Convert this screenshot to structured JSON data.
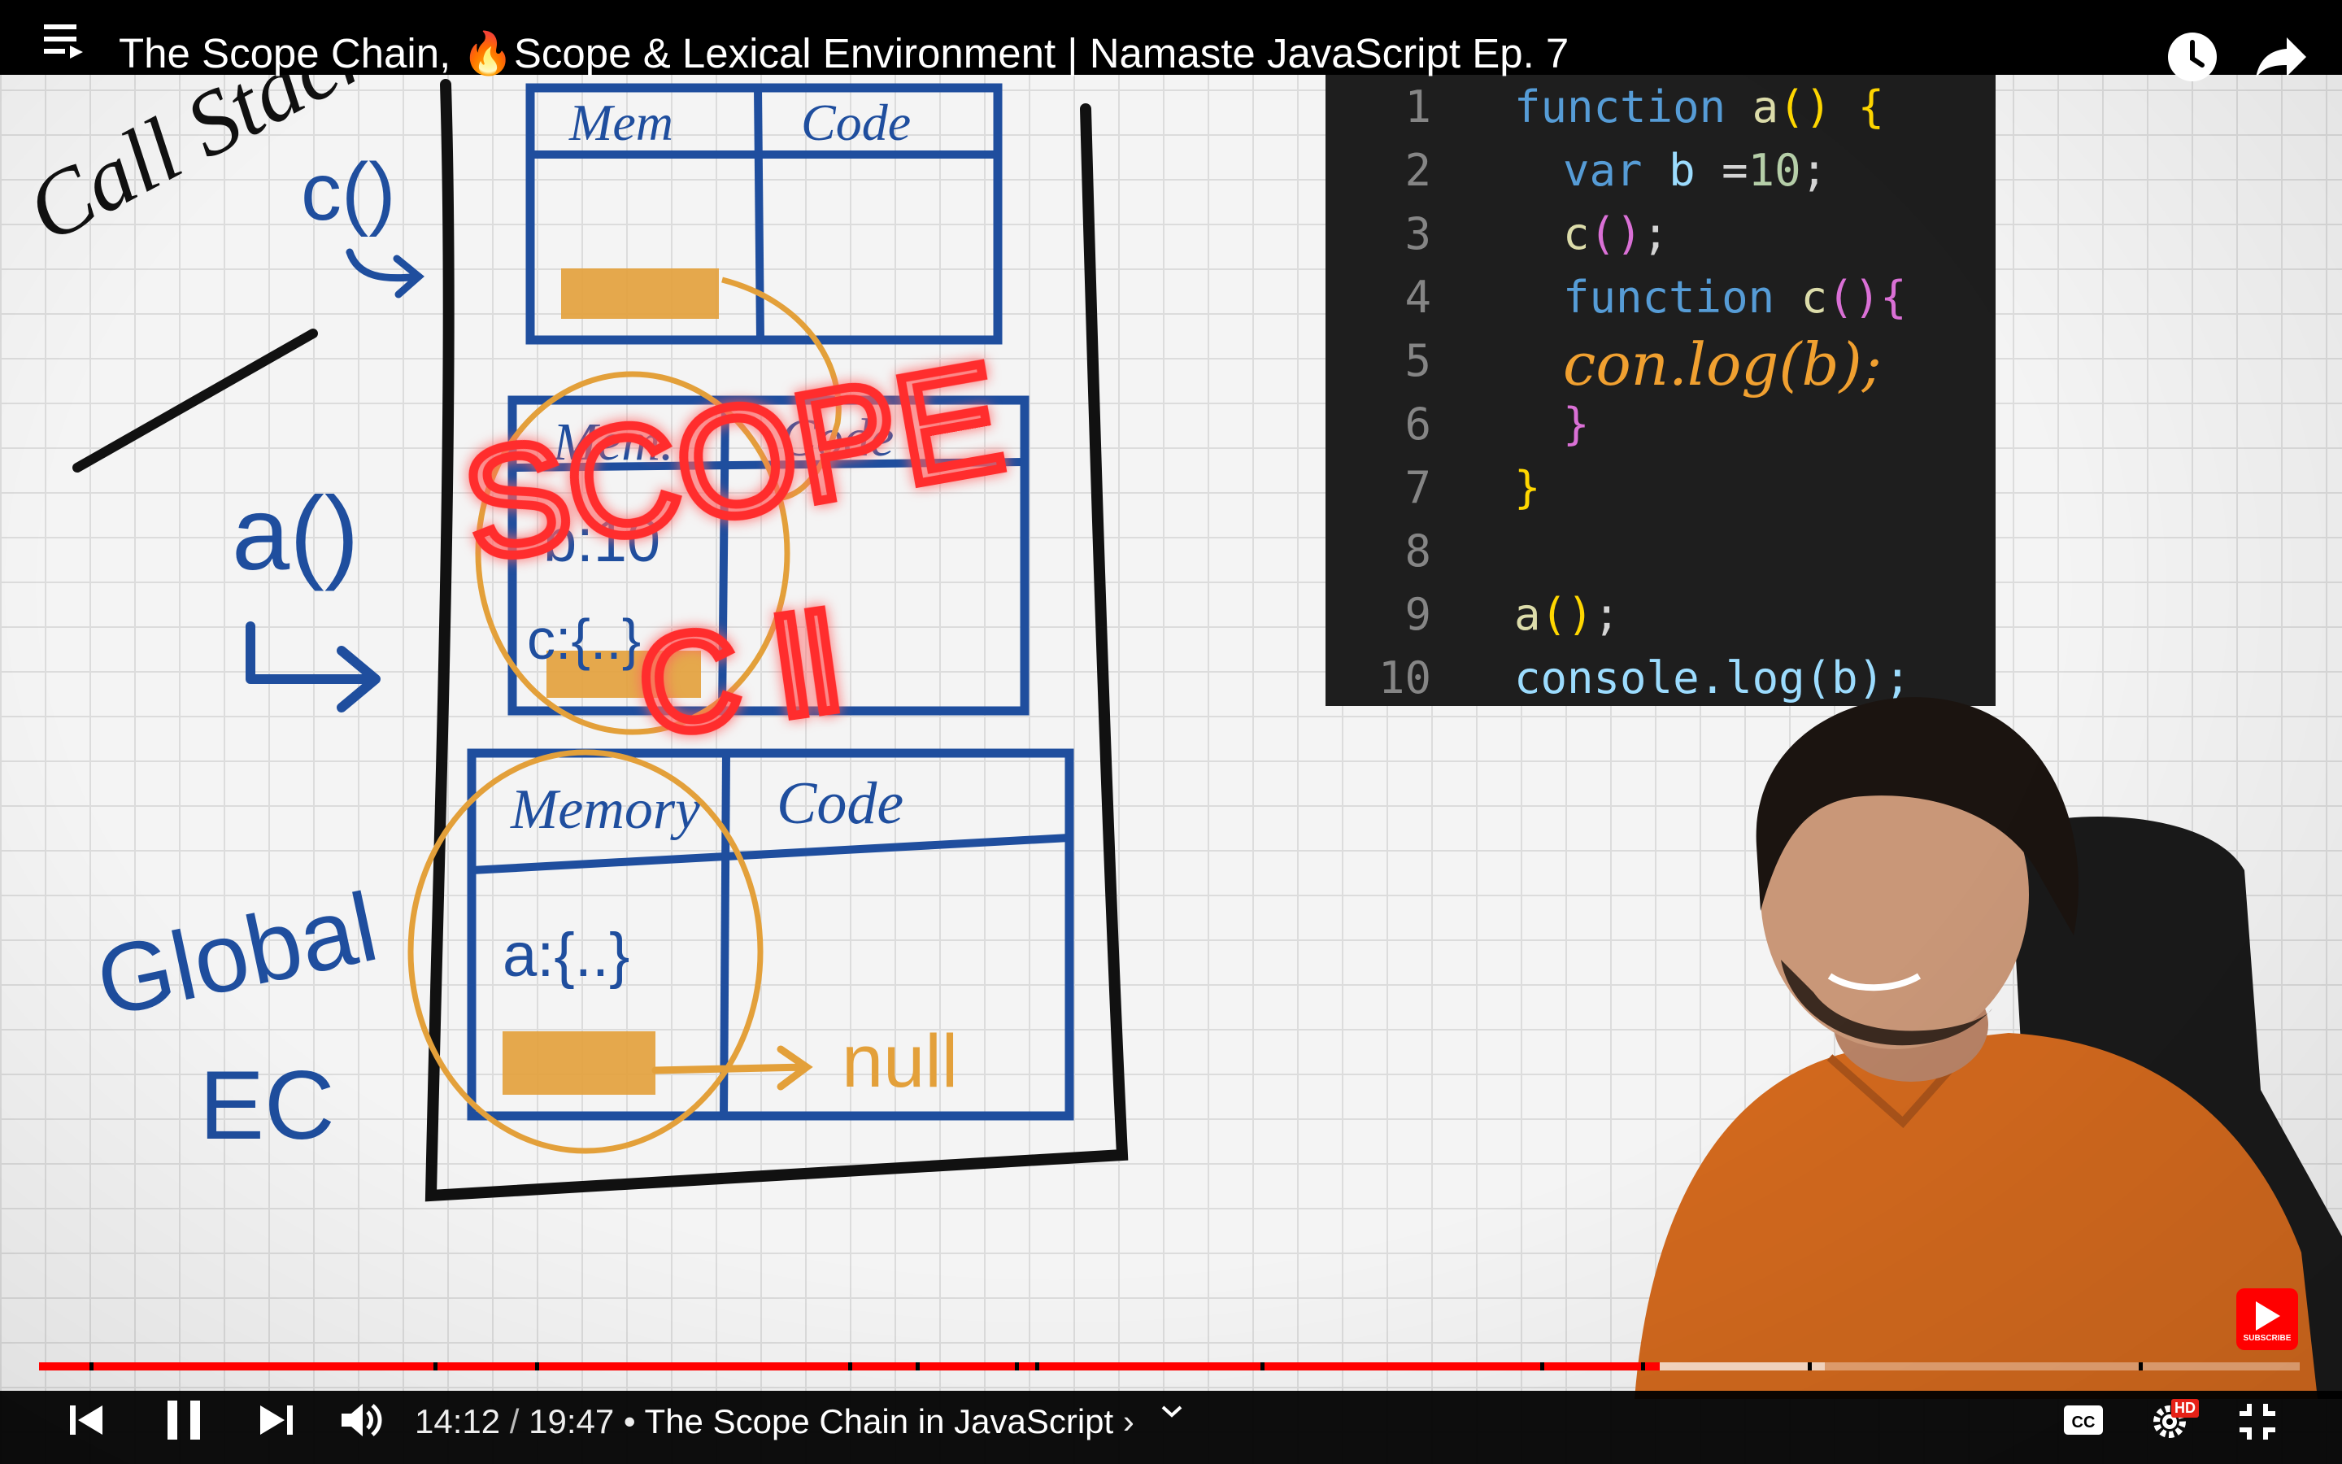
{
  "window": {
    "title": "The Scope Chain, 🔥Scope & Lexical Environment | Namaste JavaScript Ep. 7"
  },
  "top_bar": {
    "menu_icon": "playlist-icon",
    "watch_later_icon": "clock-icon",
    "share_icon": "share-arrow-icon"
  },
  "whiteboard": {
    "labels": {
      "call_stack": "Call Stack",
      "c_frame": "c()",
      "a_frame": "a()",
      "global_ec_line1": "Global",
      "global_ec_line2": "EC",
      "scope_word": "SCOPE",
      "chain_word": "C ll",
      "null_word": "null"
    },
    "c_context": {
      "memory_header": "Mem",
      "code_header": "Code"
    },
    "a_context": {
      "memory_header": "Mem.",
      "code_header": "Code",
      "memory_line1": "b:10",
      "memory_line2": "c:{..}"
    },
    "global_context": {
      "memory_header": "Memory",
      "code_header": "Code",
      "memory_line1": "a:{..}"
    },
    "colors": {
      "board_blue": "#1f4e9e",
      "marker_black": "#111111",
      "marker_orange": "#e3a03a",
      "neon_red": "#ff2d2d"
    }
  },
  "code_editor": {
    "lines": [
      {
        "num": "1",
        "text": "function a() {"
      },
      {
        "num": "2",
        "text": "var b =10;"
      },
      {
        "num": "3",
        "text": "c();"
      },
      {
        "num": "4",
        "text": "function c(){"
      },
      {
        "num": "5",
        "text": "con.log(b);"
      },
      {
        "num": "6",
        "text": "}"
      },
      {
        "num": "7",
        "text": "}"
      },
      {
        "num": "8",
        "text": ""
      },
      {
        "num": "9",
        "text": "a();"
      },
      {
        "num": "10",
        "text": "console.log(b);"
      }
    ]
  },
  "player": {
    "current_time": "14:12",
    "separator": "/",
    "duration": "19:47",
    "chapter_prefix": "•",
    "chapter_title": "The Scope Chain in JavaScript",
    "chapter_chevron": "›",
    "progress_played_fraction": 0.717,
    "progress_buffered_fraction": 0.79,
    "subscribe_label": "SUBSCRIBE",
    "quality_badge": "HD",
    "icons": {
      "previous": "skip-previous-icon",
      "pause": "pause-icon",
      "next": "skip-next-icon",
      "volume": "volume-icon",
      "expand": "chevron-down-icon",
      "captions": "captions-icon",
      "settings": "settings-gear-icon",
      "exit_fullscreen": "exit-fullscreen-icon"
    },
    "accent_color": "#ff0000"
  }
}
